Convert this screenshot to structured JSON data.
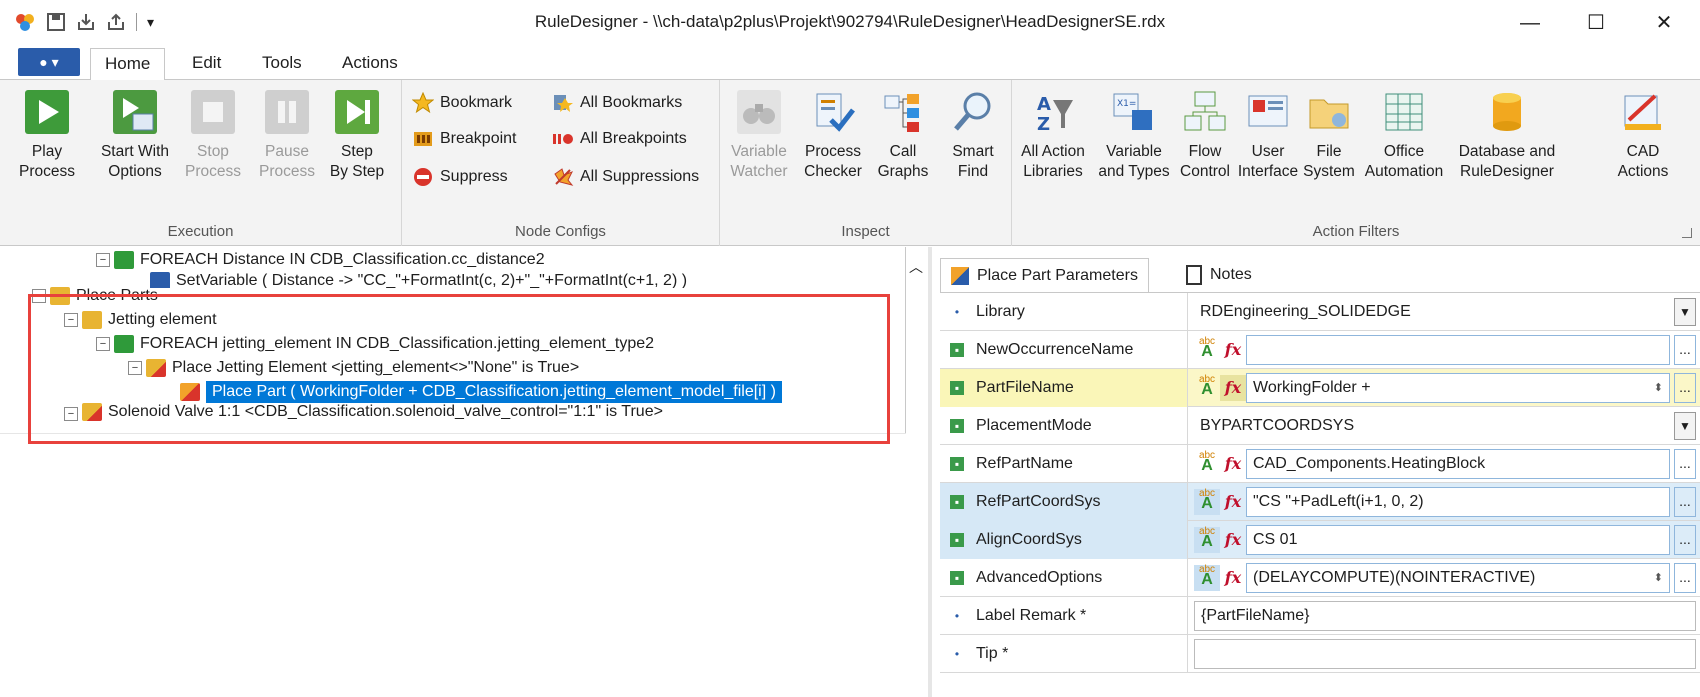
{
  "window": {
    "title": "RuleDesigner - \\\\ch-data\\p2plus\\Projekt\\902794\\RuleDesigner\\HeadDesignerSE.rdx",
    "minimize": "—",
    "maximize": "☐",
    "close": "✕"
  },
  "tabs": [
    {
      "label": "Home"
    },
    {
      "label": "Edit"
    },
    {
      "label": "Tools"
    },
    {
      "label": "Actions"
    }
  ],
  "ribbon": {
    "execution": {
      "label": "Execution",
      "buttons": [
        {
          "line1": "Play",
          "line2": "Process"
        },
        {
          "line1": "Start With",
          "line2": "Options"
        },
        {
          "line1": "Stop",
          "line2": "Process"
        },
        {
          "line1": "Pause",
          "line2": "Process"
        },
        {
          "line1": "Step",
          "line2": "By Step"
        }
      ]
    },
    "node_configs": {
      "label": "Node Configs",
      "bookmark": "Bookmark",
      "breakpoint": "Breakpoint",
      "suppress": "Suppress",
      "all_bookmarks": "All Bookmarks",
      "all_breakpoints": "All Breakpoints",
      "all_suppressions": "All Suppressions"
    },
    "inspect": {
      "label": "Inspect",
      "buttons": [
        {
          "line1": "Variable",
          "line2": "Watcher"
        },
        {
          "line1": "Process",
          "line2": "Checker"
        },
        {
          "line1": "Call",
          "line2": "Graphs"
        },
        {
          "line1": "Smart",
          "line2": "Find"
        }
      ]
    },
    "action_filters": {
      "label": "Action Filters",
      "buttons": [
        {
          "line1": "All Action",
          "line2": "Libraries"
        },
        {
          "line1": "Variable",
          "line2": "and Types"
        },
        {
          "line1": "Flow",
          "line2": "Control"
        },
        {
          "line1": "User",
          "line2": "Interface"
        },
        {
          "line1": "File",
          "line2": "System"
        },
        {
          "line1": "Office",
          "line2": "Automation"
        },
        {
          "line1": "Database and",
          "line2": "RuleDesigner"
        },
        {
          "line1": "CAD",
          "line2": "Actions"
        }
      ]
    }
  },
  "tree": {
    "items": [
      {
        "text": "FOREACH Distance IN CDB_Classification.cc_distance2"
      },
      {
        "text": "SetVariable ( Distance -> \"CC_\"+FormatInt(c, 2)+\"_\"+FormatInt(c+1, 2) )"
      },
      {
        "text": "Place Parts"
      },
      {
        "text": "Jetting element"
      },
      {
        "text": "FOREACH jetting_element IN CDB_Classification.jetting_element_type2"
      },
      {
        "text": "Place Jetting Element <jetting_element<>\"None\" is True>"
      },
      {
        "text": "Place Part ( WorkingFolder + CDB_Classification.jetting_element_model_file[i] )"
      },
      {
        "text": "Solenoid Valve 1:1 <CDB_Classification.solenoid_valve_control=\"1:1\" is True>"
      }
    ]
  },
  "properties": {
    "tabs": [
      {
        "label": "Place Part Parameters"
      },
      {
        "label": "Notes"
      }
    ],
    "rows": [
      {
        "name": "Library",
        "value": "RDEngineering_SOLIDEDGE"
      },
      {
        "name": "NewOccurrenceName",
        "value": ""
      },
      {
        "name": "PartFileName",
        "value": "WorkingFolder +"
      },
      {
        "name": "PlacementMode",
        "value": "BYPARTCOORDSYS"
      },
      {
        "name": "RefPartName",
        "value": "CAD_Components.HeatingBlock"
      },
      {
        "name": "RefPartCoordSys",
        "value": "\"CS \"+PadLeft(i+1, 0, 2)"
      },
      {
        "name": "AlignCoordSys",
        "value": "CS 01"
      },
      {
        "name": "AdvancedOptions",
        "value": "(DELAYCOMPUTE)(NOINTERACTIVE)"
      },
      {
        "name": "Label Remark *",
        "value": "{PartFileName}"
      },
      {
        "name": "Tip *",
        "value": ""
      }
    ]
  }
}
